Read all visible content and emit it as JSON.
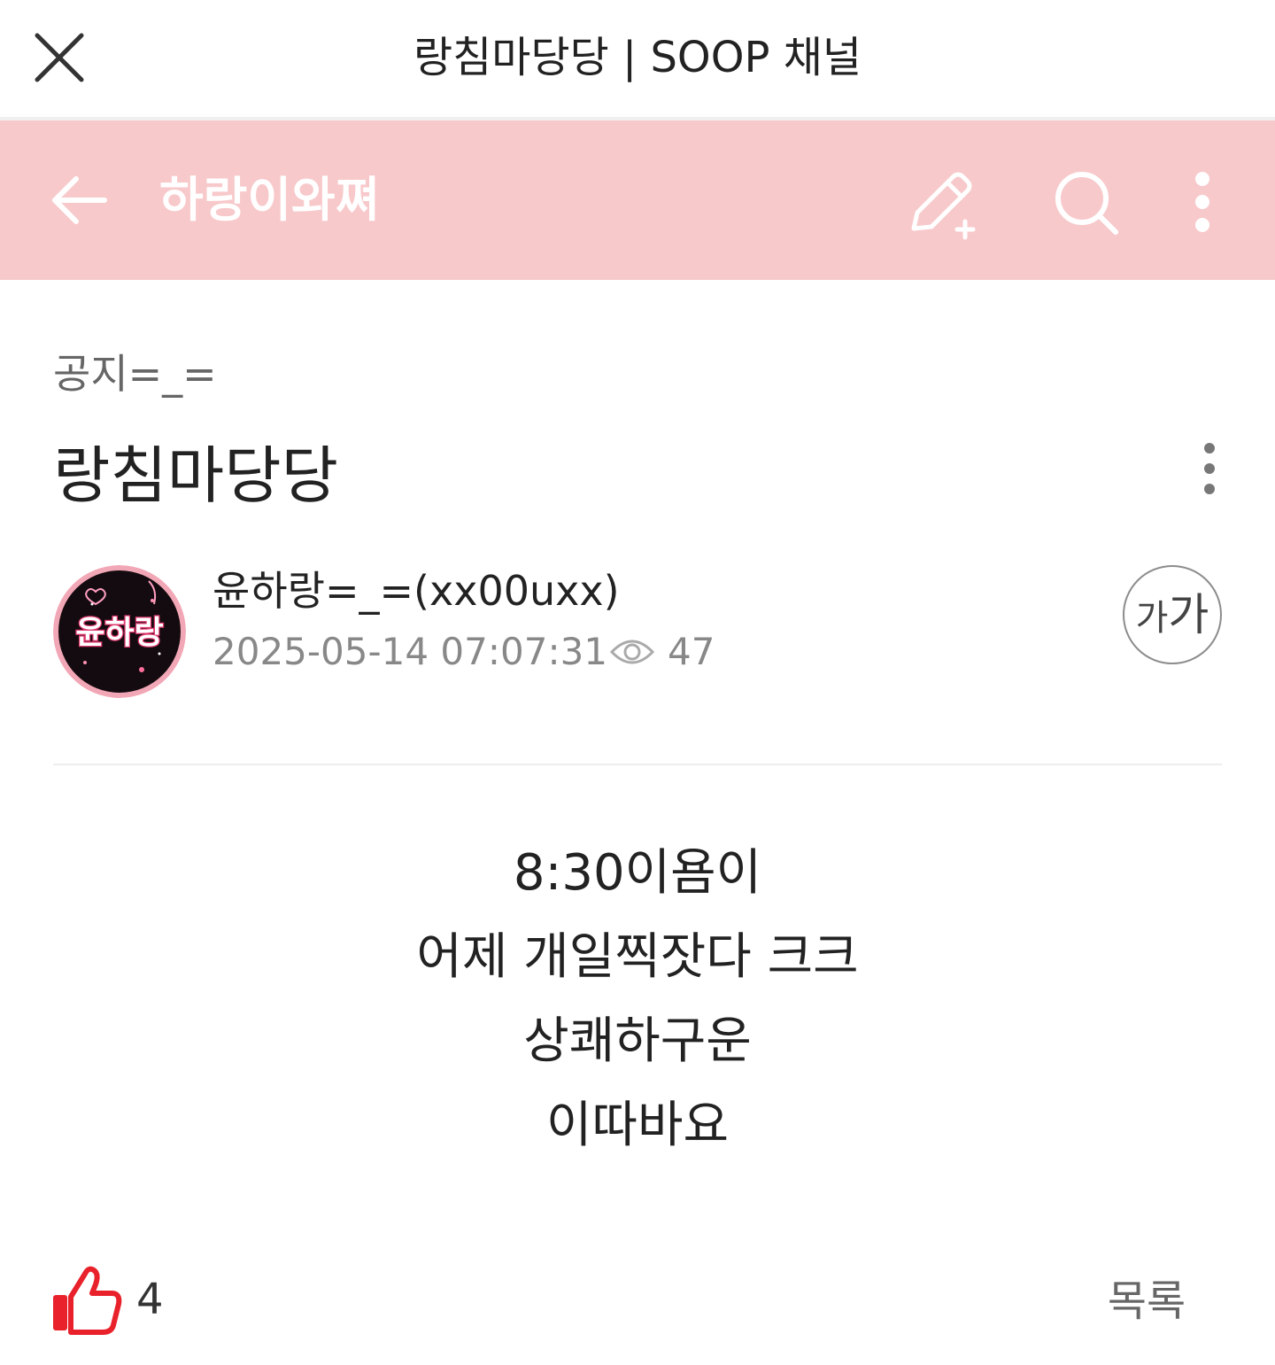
{
  "webview": {
    "title": "랑침마당당 | SOOP 채널",
    "close_icon": "close-icon"
  },
  "header": {
    "channel_name": "하랑이와쪄",
    "background_color": "#f8c9cb",
    "icons": [
      "back-arrow-icon",
      "write-icon",
      "search-icon",
      "more-vertical-icon"
    ]
  },
  "post": {
    "category": "공지=_=",
    "title": "랑침마당당",
    "author": "윤하랑=_=(xx00uxx)",
    "date": "2025-05-14 07:07:31",
    "views": "47",
    "avatar_text": "윤하랑",
    "font_size_button": {
      "small": "가",
      "large": "가"
    },
    "body_lines": [
      "8:30이욤이",
      "어제 개일찍잣다 크크",
      "상쾌하구운",
      "이따바요"
    ],
    "likes": "4",
    "like_color": "#e8212b",
    "list_button": "목록"
  }
}
